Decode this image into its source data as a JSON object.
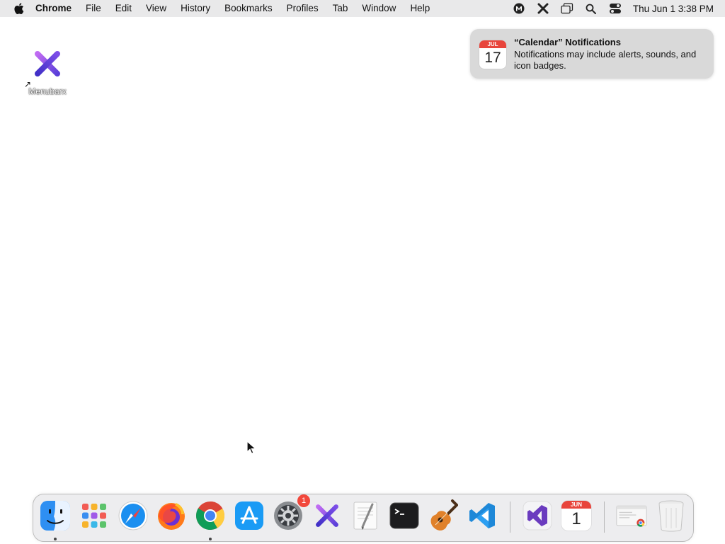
{
  "menubar": {
    "app_name": "Chrome",
    "menus": [
      "File",
      "Edit",
      "View",
      "History",
      "Bookmarks",
      "Profiles",
      "Tab",
      "Window",
      "Help"
    ],
    "clock": "Thu Jun 1  3:38 PM"
  },
  "desktop": {
    "icon_label": "Menubarx"
  },
  "notification": {
    "title": "“Calendar” Notifications",
    "body": "Notifications may include alerts, sounds, and icon badges.",
    "icon_month": "JUL",
    "icon_day": "17"
  },
  "dock": {
    "settings_badge": "1",
    "calendar_month": "JUN",
    "calendar_day": "1"
  }
}
